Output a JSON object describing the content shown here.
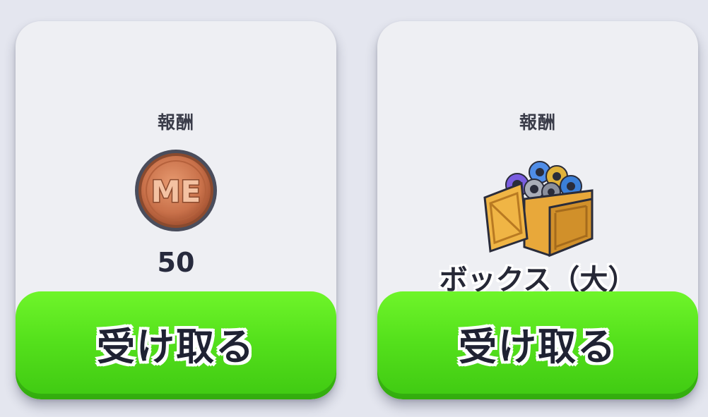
{
  "cards": [
    {
      "reward_label": "報酬",
      "icon": "me-coin-icon",
      "icon_text": "ME",
      "amount": "50",
      "button_label": "受け取る",
      "button_color": "#55e11c"
    },
    {
      "reward_label": "報酬",
      "icon": "gear-crate-icon",
      "item_name": "ボックス（大）",
      "button_label": "受け取る",
      "button_color": "#55e11c"
    }
  ],
  "colors": {
    "background": "#e4e6ef",
    "card": "#eeeff3",
    "coin": "#c9714a",
    "crate": "#e8a83a"
  }
}
